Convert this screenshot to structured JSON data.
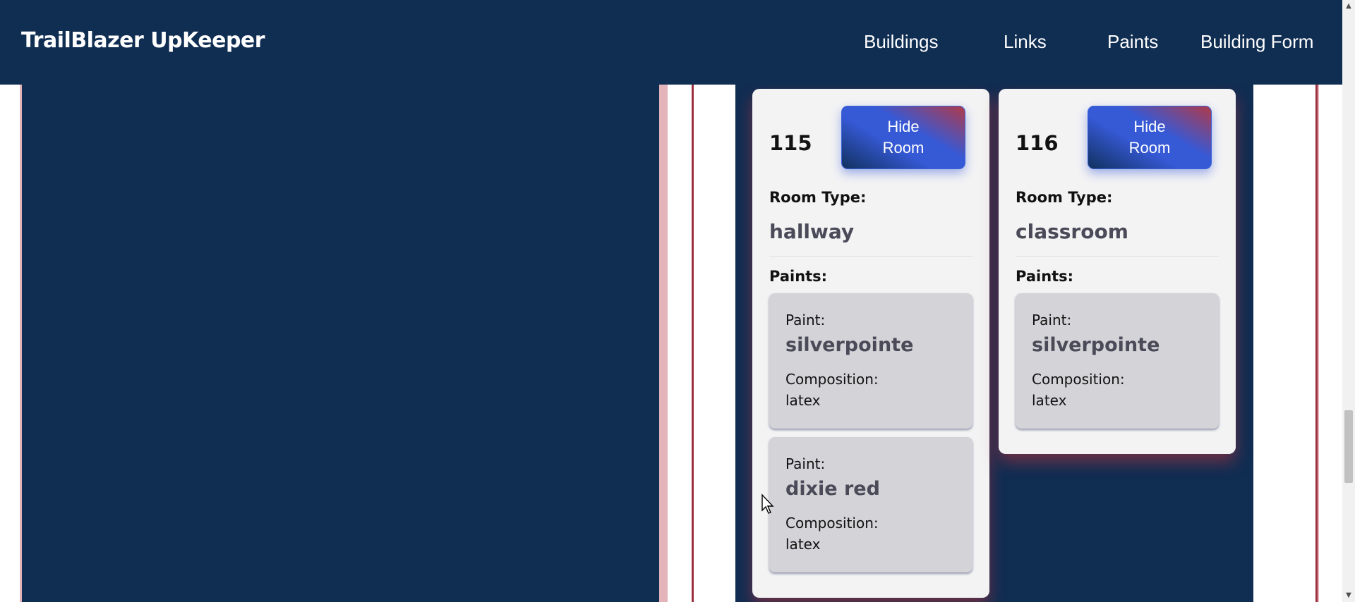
{
  "navbar": {
    "brand": "TrailBlazer UpKeeper",
    "links": [
      "Buildings",
      "Links",
      "Paints",
      "Building Form"
    ]
  },
  "rooms": [
    {
      "number": "115",
      "hide_label_line1": "Hide",
      "hide_label_line2": "Room",
      "room_type_label": "Room Type:",
      "room_type": "hallway",
      "paints_label": "Paints:",
      "paints": [
        {
          "paint_label": "Paint:",
          "name": "silverpointe",
          "composition_label": "Composition:",
          "composition": "latex"
        },
        {
          "paint_label": "Paint:",
          "name": "dixie red",
          "composition_label": "Composition:",
          "composition": "latex"
        }
      ]
    },
    {
      "number": "116",
      "hide_label_line1": "Hide",
      "hide_label_line2": "Room",
      "room_type_label": "Room Type:",
      "room_type": "classroom",
      "paints_label": "Paints:",
      "paints": [
        {
          "paint_label": "Paint:",
          "name": "silverpointe",
          "composition_label": "Composition:",
          "composition": "latex"
        }
      ]
    }
  ],
  "colors": {
    "navy": "#102d52",
    "accent_red": "#9c2f3d",
    "button_blue": "#3659d6"
  },
  "icons": {
    "scroll_up": "scroll-up-arrow-icon",
    "scroll_down": "scroll-down-arrow-icon",
    "cursor": "mouse-pointer-icon"
  }
}
